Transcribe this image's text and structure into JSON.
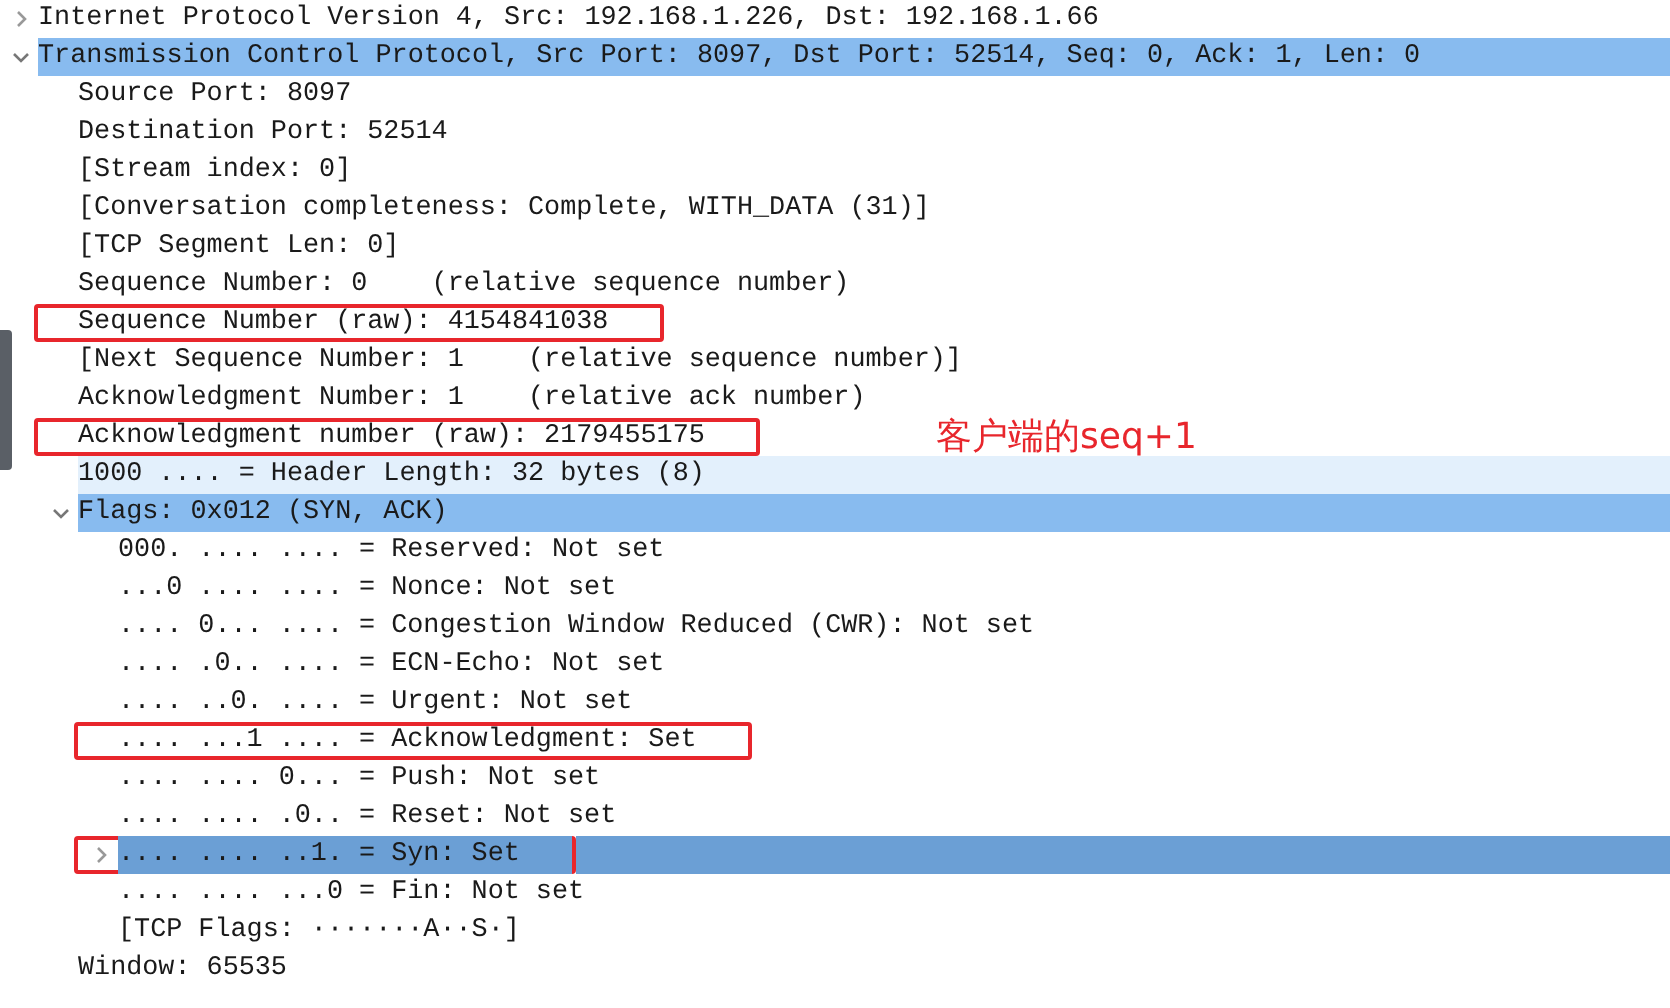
{
  "tree": [
    {
      "label": "Internet Protocol Version 4, Src: 192.168.1.226, Dst: 192.168.1.66",
      "expanded": false,
      "selected": false
    },
    {
      "label": "Transmission Control Protocol, Src Port: 8097, Dst Port: 52514, Seq: 0, Ack: 1, Len: 0",
      "expanded": true,
      "selected": false,
      "children": [
        {
          "label": "Source Port: 8097",
          "selected": false
        },
        {
          "label": "Destination Port: 52514",
          "selected": false
        },
        {
          "label": "[Stream index: 0]",
          "selected": false
        },
        {
          "label": "[Conversation completeness: Complete, WITH_DATA (31)]",
          "selected": false
        },
        {
          "label": "[TCP Segment Len: 0]",
          "selected": false
        },
        {
          "label": "Sequence Number: 0    (relative sequence number)",
          "selected": false
        },
        {
          "label": "Sequence Number (raw): 4154841038",
          "selected": false,
          "annotated": true
        },
        {
          "label": "[Next Sequence Number: 1    (relative sequence number)]",
          "selected": false
        },
        {
          "label": "Acknowledgment Number: 1    (relative ack number)",
          "selected": false
        },
        {
          "label": "Acknowledgment number (raw): 2179455175",
          "selected": false,
          "annotated": true,
          "note": "客户端的seq+1"
        },
        {
          "label": "1000 .... = Header Length: 32 bytes (8)",
          "selected": false,
          "hovered": true
        },
        {
          "label": "Flags: 0x012 (SYN, ACK)",
          "expanded": true,
          "selected": false,
          "children": [
            {
              "label": "000. .... .... = Reserved: Not set",
              "selected": false
            },
            {
              "label": "...0 .... .... = Nonce: Not set",
              "selected": false
            },
            {
              "label": ".... 0... .... = Congestion Window Reduced (CWR): Not set",
              "selected": false
            },
            {
              "label": ".... .0.. .... = ECN-Echo: Not set",
              "selected": false
            },
            {
              "label": ".... ..0. .... = Urgent: Not set",
              "selected": false
            },
            {
              "label": ".... ...1 .... = Acknowledgment: Set",
              "selected": false,
              "annotated": true
            },
            {
              "label": ".... .... 0... = Push: Not set",
              "selected": false
            },
            {
              "label": ".... .... .0.. = Reset: Not set",
              "selected": false
            },
            {
              "label": ".... .... ..1. = Syn: Set",
              "expanded": false,
              "selected": true,
              "annotated": true
            },
            {
              "label": ".... .... ...0 = Fin: Not set",
              "selected": false
            },
            {
              "label": "[TCP Flags: ·······A··S·]",
              "selected": false
            }
          ]
        },
        {
          "label": "Window: 65535",
          "selected": false
        }
      ]
    }
  ]
}
